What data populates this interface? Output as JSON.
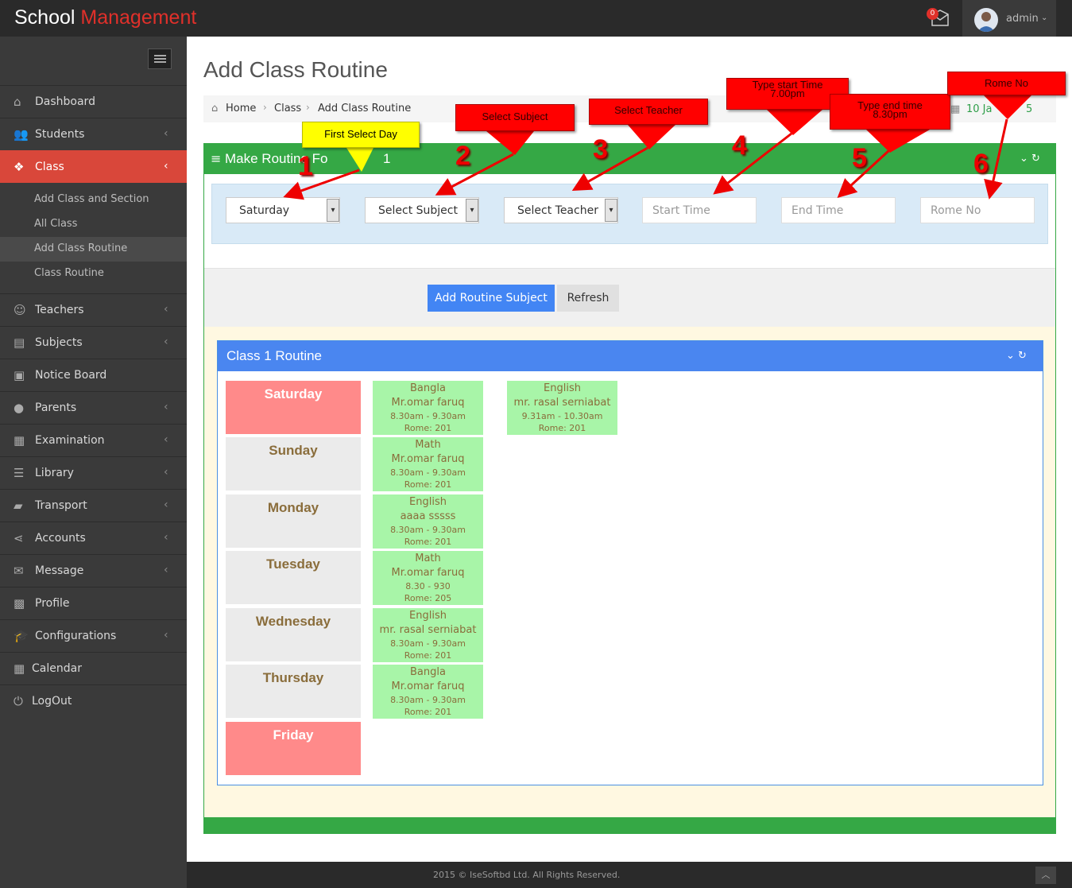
{
  "topbar": {
    "brand_part1": "School ",
    "brand_part2": "Management",
    "mail_count": "0",
    "username": "admin"
  },
  "sidebar": {
    "items": [
      {
        "label": "Dashboard"
      },
      {
        "label": "Students"
      },
      {
        "label": "Class"
      },
      {
        "label": "Teachers"
      },
      {
        "label": "Subjects"
      },
      {
        "label": "Notice Board"
      },
      {
        "label": "Parents"
      },
      {
        "label": "Examination"
      },
      {
        "label": "Library"
      },
      {
        "label": "Transport"
      },
      {
        "label": "Accounts"
      },
      {
        "label": "Message"
      },
      {
        "label": "Profile"
      },
      {
        "label": "Configurations"
      },
      {
        "label": "Calendar"
      },
      {
        "label": "LogOut"
      }
    ],
    "class_sub": [
      {
        "label": "Add Class and Section"
      },
      {
        "label": "All Class"
      },
      {
        "label": "Add Class Routine"
      },
      {
        "label": "Class Routine"
      }
    ]
  },
  "page": {
    "title": "Add Class Routine",
    "breadcrumb": [
      "Home",
      "Class",
      "Add Class Routine"
    ],
    "date": "10 Ja",
    "date_tail": "5"
  },
  "form_panel": {
    "title": "Make Routine Fo",
    "title_tail": "1",
    "day_select": "Saturday",
    "subject_select": "Select Subject",
    "teacher_select": "Select Teacher",
    "start_placeholder": "Start Time",
    "end_placeholder": "End Time",
    "room_placeholder": "Rome No",
    "add_button": "Add Routine Subject",
    "refresh_button": "Refresh"
  },
  "routine": {
    "title": "Class 1 Routine",
    "days": [
      "Saturday",
      "Sunday",
      "Monday",
      "Tuesday",
      "Wednesday",
      "Thursday",
      "Friday"
    ],
    "slots": [
      {
        "subject": "Bangla",
        "teacher": "Mr.omar faruq",
        "time": "8.30am - 9.30am",
        "room": "Rome: 201"
      },
      {
        "subject": "English",
        "teacher": "mr. rasal serniabat",
        "time": "9.31am - 10.30am",
        "room": "Rome: 201"
      },
      {
        "subject": "Math",
        "teacher": "Mr.omar faruq",
        "time": "8.30am - 9.30am",
        "room": "Rome: 201"
      },
      {
        "subject": "English",
        "teacher": "aaaa sssss",
        "time": "8.30am - 9.30am",
        "room": "Rome: 201"
      },
      {
        "subject": "Math",
        "teacher": "Mr.omar faruq",
        "time": "8.30 - 930",
        "room": "Rome: 205"
      },
      {
        "subject": "English",
        "teacher": "mr. rasal serniabat",
        "time": "8.30am - 9.30am",
        "room": "Rome: 201"
      },
      {
        "subject": "Bangla",
        "teacher": "Mr.omar faruq",
        "time": "8.30am - 9.30am",
        "room": "Rome: 201"
      }
    ]
  },
  "annotations": {
    "c1": "First Select Day",
    "c2": "Select Subject",
    "c3": "Select Teacher",
    "c4a": "Type start Time",
    "c4b": "7.00pm",
    "c5a": "Type end time",
    "c5b": "8.30pm",
    "c6": "Rome No",
    "n1": "1",
    "n2": "2",
    "n3": "3",
    "n4": "4",
    "n5": "5",
    "n6": "6"
  },
  "footer": {
    "text": "2015 © IseSoftbd Ltd. All Rights Reserved."
  }
}
